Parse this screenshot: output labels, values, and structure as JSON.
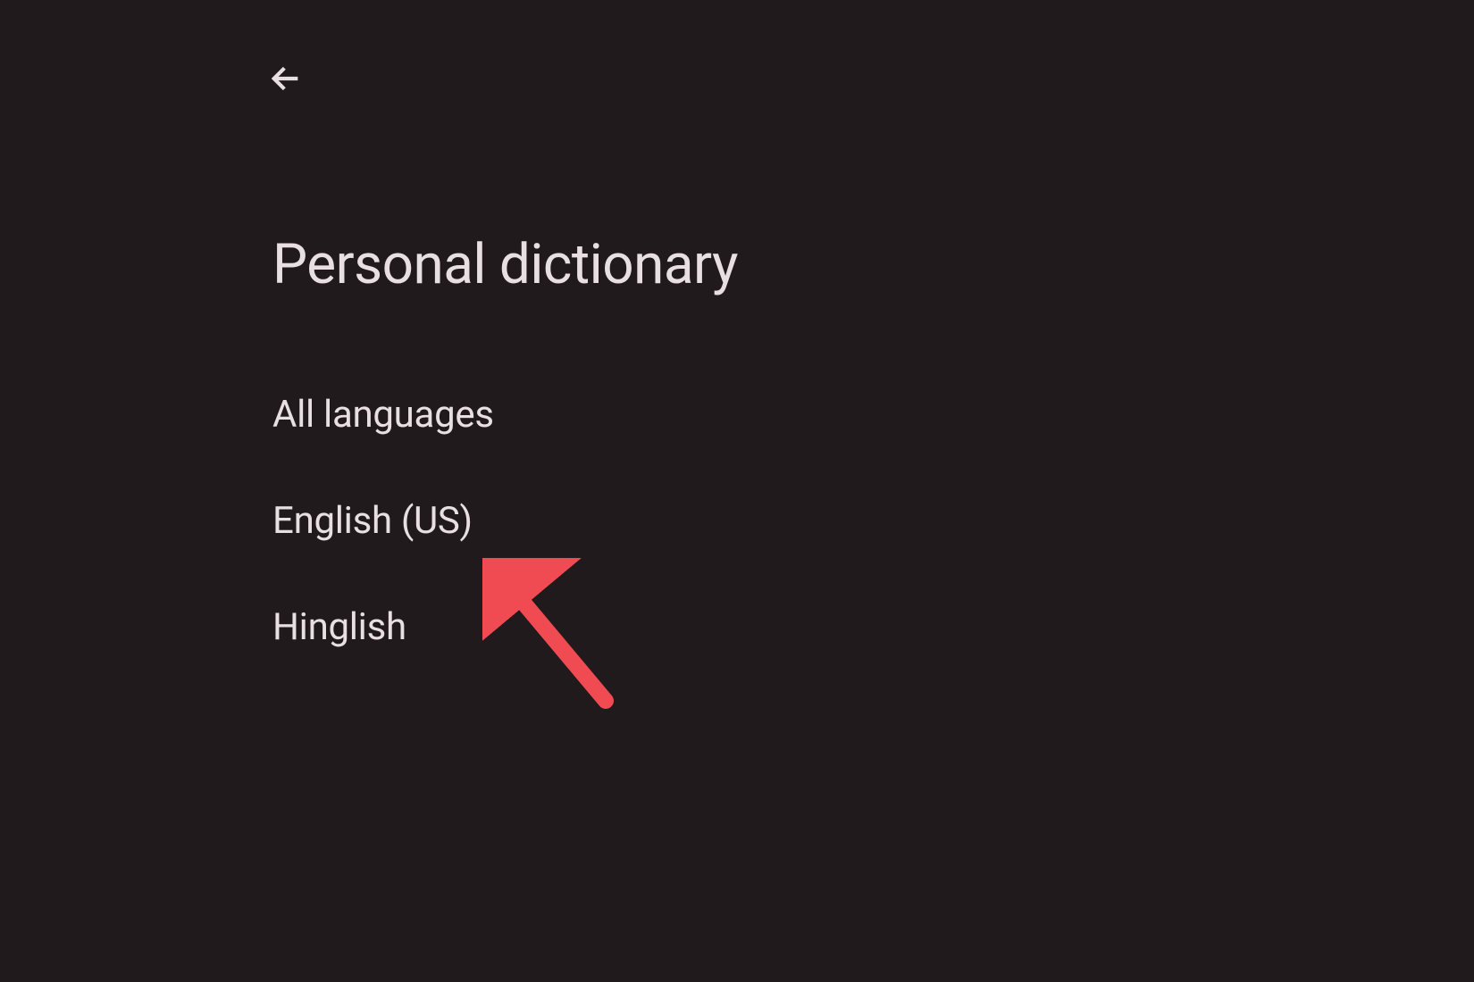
{
  "header": {
    "title": "Personal dictionary"
  },
  "list": {
    "items": [
      {
        "label": "All languages"
      },
      {
        "label": "English (US)"
      },
      {
        "label": "Hinglish"
      }
    ]
  },
  "annotation": {
    "color": "#f04a52"
  }
}
